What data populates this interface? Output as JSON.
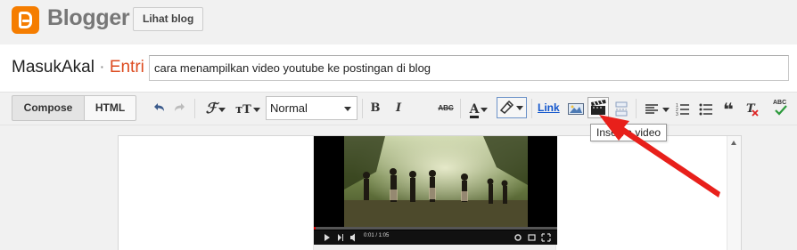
{
  "header": {
    "brand": "Blogger",
    "view_blog_label": "Lihat blog"
  },
  "editor": {
    "blog_name": "MasukAkal",
    "separator": " · ",
    "section": "Entri",
    "post_title": "cara menampilkan video youtube ke postingan di blog"
  },
  "toolbar": {
    "compose_label": "Compose",
    "html_label": "HTML",
    "font_icon": "font-icon",
    "font_size_icon": "font-size-icon",
    "format_value": "Normal",
    "bold_label": "B",
    "italic_label": "I",
    "strike_label": "ABC",
    "text_color_label": "A",
    "link_label": "Link",
    "quote_label": "❝",
    "spell_label": "ABC",
    "tooltip": "Insert a video"
  },
  "video": {
    "time": "0:01 / 1:05"
  },
  "colors": {
    "accent": "#f57d00",
    "crumb": "#dd4b1f",
    "link": "#1155cc",
    "arrow": "#e8201b"
  }
}
